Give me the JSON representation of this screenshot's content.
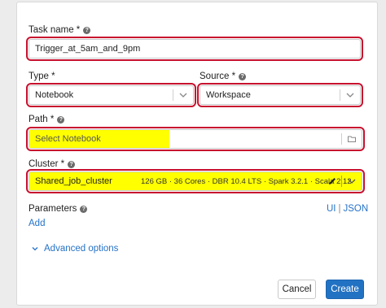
{
  "task_name": {
    "label": "Task name *",
    "value": "Trigger_at_5am_and_9pm"
  },
  "type": {
    "label": "Type *",
    "value": "Notebook"
  },
  "source": {
    "label": "Source *",
    "value": "Workspace"
  },
  "path": {
    "label": "Path *",
    "placeholder": "Select Notebook"
  },
  "cluster": {
    "label": "Cluster *",
    "value": "Shared_job_cluster",
    "detail": "126 GB · 36 Cores · DBR 10.4 LTS · Spark 3.2.1 · Scala 2.12"
  },
  "parameters": {
    "label": "Parameters",
    "add": "Add",
    "ui": "UI",
    "divider": "|",
    "json": "JSON"
  },
  "advanced_options": "Advanced options",
  "buttons": {
    "cancel": "Cancel",
    "create": "Create"
  },
  "colors": {
    "highlight": "#ffff00",
    "annotation": "#c8102e",
    "accent": "#2272c3"
  }
}
